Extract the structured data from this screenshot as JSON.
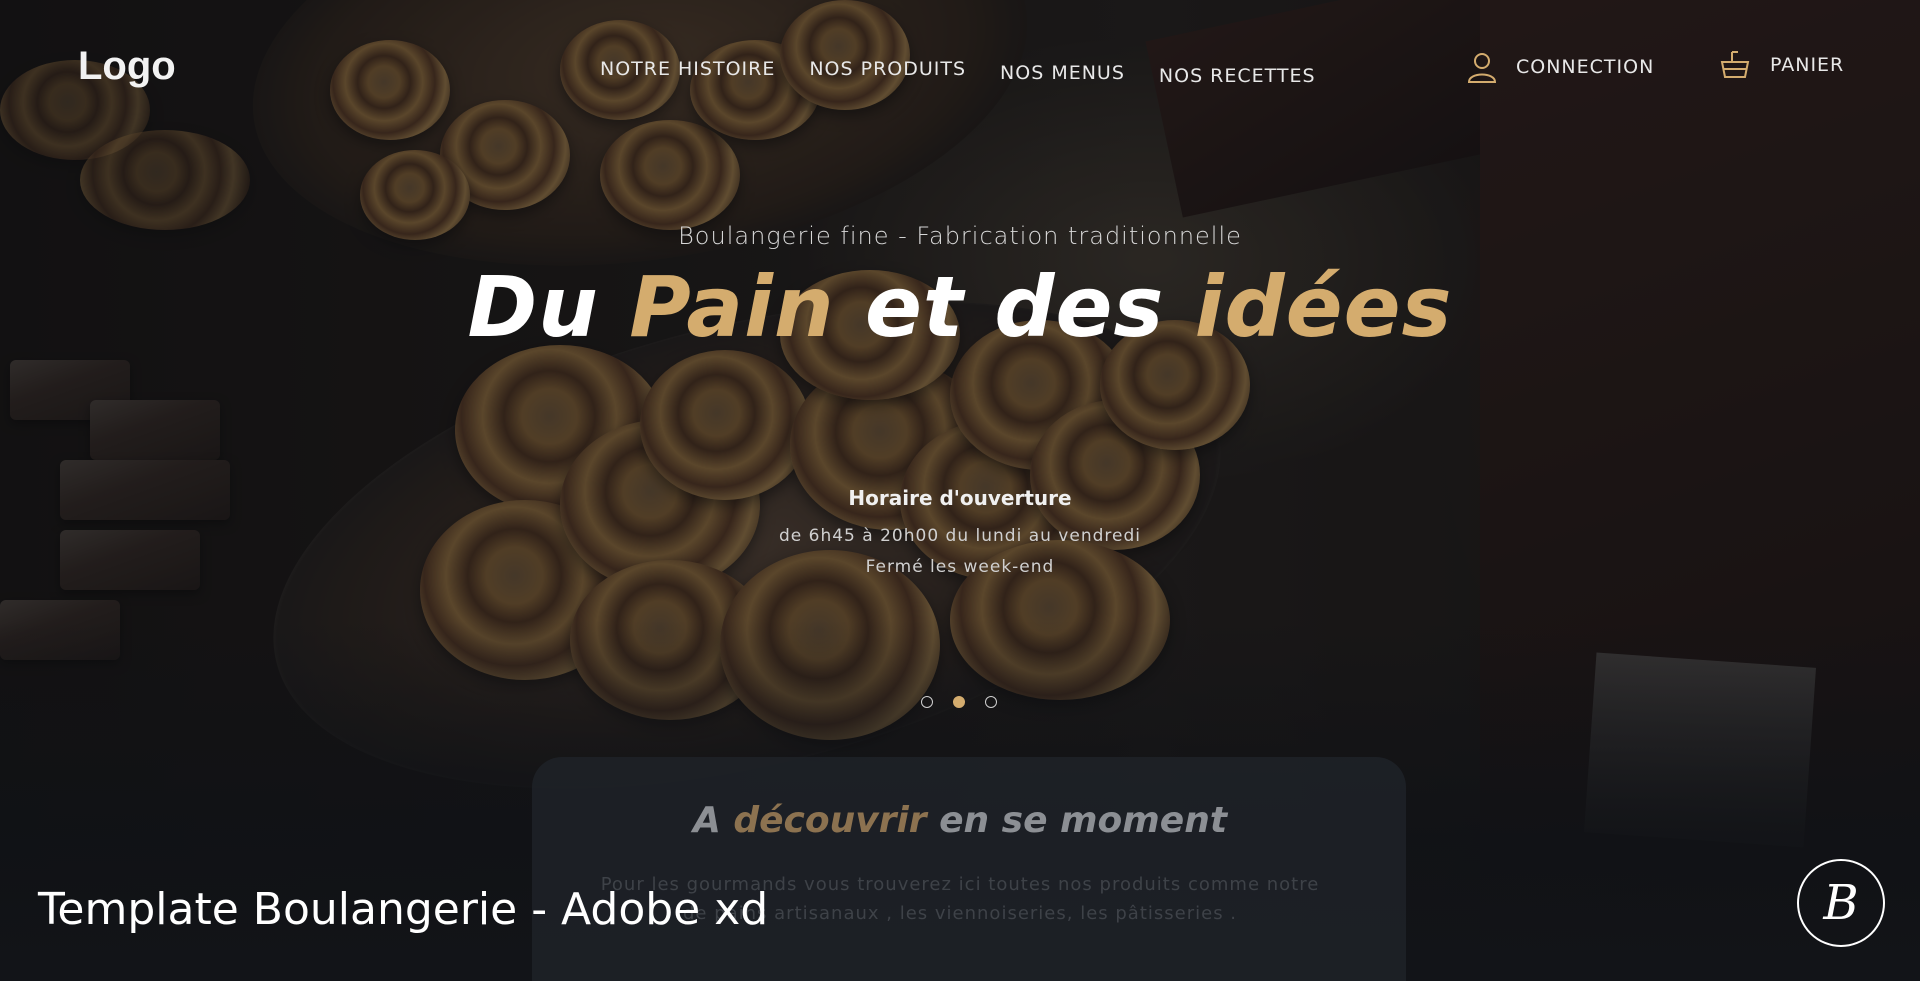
{
  "header": {
    "logo": "Logo",
    "nav": [
      "NOTRE HISTOIRE",
      "NOS PRODUITS",
      "NOS MENUS",
      "NOS RECETTES"
    ],
    "account_label": "CONNECTION",
    "account_icon": "user-icon",
    "cart_label": "PANIER",
    "cart_icon": "basket-icon"
  },
  "hero": {
    "tagline": "Boulangerie fine  - Fabrication traditionnelle",
    "headline": {
      "part1": "Du ",
      "part2": "Pain",
      "part3": " et des ",
      "part4": "idées"
    },
    "hours_title": "Horaire d'ouverture",
    "hours_line1": "de 6h45 à 20h00 du lundi au vendredi",
    "hours_line2": "Fermé les week-end",
    "slider_dots": 3,
    "active_slide": 2
  },
  "discover": {
    "title_part1": "A ",
    "title_part2": "découvrir",
    "title_part3": " en se moment",
    "text_line1": "Pour les gourmands vous trouverez ici toutes nos produits comme notre",
    "text_line2": "de pains artisanaux , les viennoiseries, les pâtisseries ."
  },
  "footer": {
    "caption": "Template Boulangerie - Adobe xd",
    "badge_letter": "B"
  },
  "colors": {
    "accent": "#d4ac6e",
    "text": "#ffffff"
  }
}
